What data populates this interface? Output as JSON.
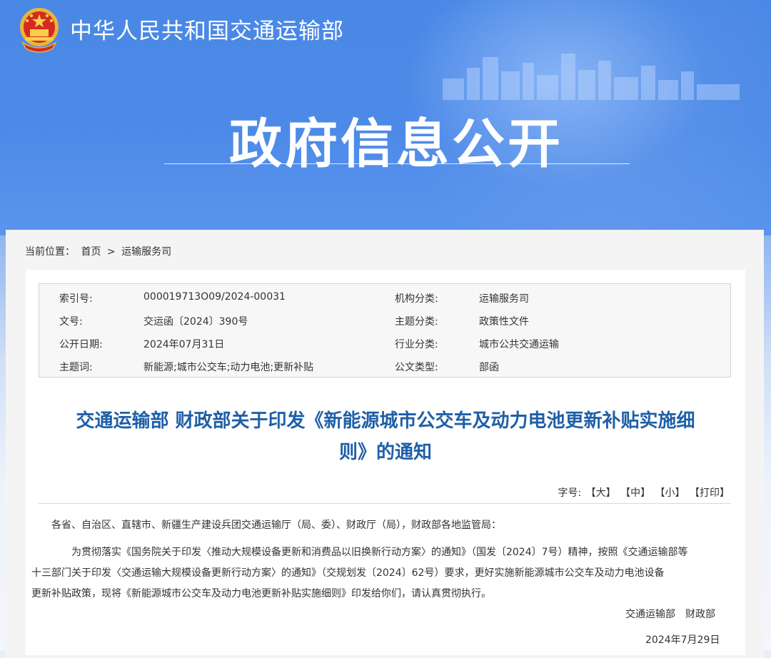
{
  "header": {
    "ministry_name": "中华人民共和国交通运输部",
    "banner_title": "政府信息公开"
  },
  "breadcrumb": {
    "label": "当前位置：",
    "home": "首页",
    "separator": ">",
    "current": "运输服务司"
  },
  "meta": {
    "rows": [
      {
        "label_left": "索引号:",
        "value_left": "000019713O09/2024-00031",
        "label_right": "机构分类:",
        "value_right": "运输服务司"
      },
      {
        "label_left": "文号:",
        "value_left": "交运函〔2024〕390号",
        "label_right": "主题分类:",
        "value_right": "政策性文件"
      },
      {
        "label_left": "公开日期:",
        "value_left": "2024年07月31日",
        "label_right": "行业分类:",
        "value_right": "城市公共交通运输"
      },
      {
        "label_left": "主题词:",
        "value_left": "新能源;城市公交车;动力电池;更新补贴",
        "label_right": "公文类型:",
        "value_right": "部函"
      }
    ]
  },
  "article": {
    "title_line1": "交通运输部 财政部关于印发《新能源城市公交车及动力电池更新补贴实施细",
    "title_line2": "则》的通知",
    "font_size_label": "字号:",
    "font_large": "【大】",
    "font_medium": "【中】",
    "font_small": "【小】",
    "print": "【打印】",
    "greeting": "各省、自治区、直辖市、新疆生产建设兵团交通运输厅（局、委）、财政厅（局），财政部各地监管局：",
    "paragraph_lines": [
      "为贯彻落实《国务院关于印发〈推动大规模设备更新和消费品以旧换新行动方案〉的通知》（国发〔2024〕7号）精神，按照《交通运输部等",
      "十三部门关于印发〈交通运输大规模设备更新行动方案〉的通知》（交规划发〔2024〕62号）要求，更好实施新能源城市公交车及动力电池设备",
      "更新补贴政策，现将《新能源城市公交车及动力电池更新补贴实施细则》印发给你们，请认真贯彻执行。"
    ],
    "signature": "交通运输部　财政部",
    "date": "2024年7月29日"
  },
  "colors": {
    "banner": "#4a88e6",
    "title_blue": "#1f5fa8"
  }
}
